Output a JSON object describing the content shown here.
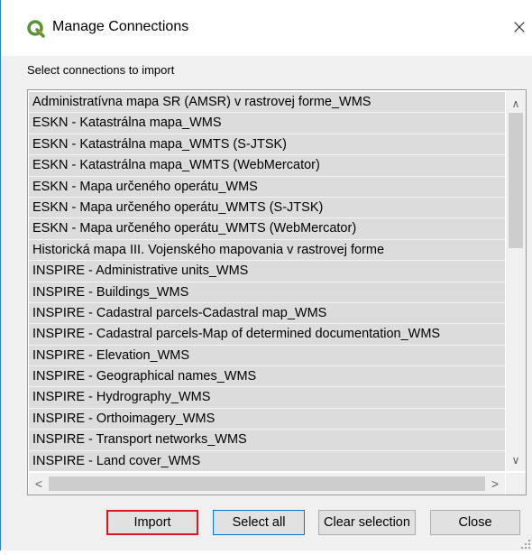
{
  "window": {
    "title": "Manage Connections",
    "close_glyph": "×",
    "app_icon": "qgis-icon",
    "accent": "#3c7fb1"
  },
  "prompt": "Select connections to import",
  "connections": [
    "Administratívna mapa SR (AMSR) v rastrovej forme_WMS",
    "ESKN - Katastrálna mapa_WMS",
    "ESKN - Katastrálna mapa_WMTS (S-JTSK)",
    "ESKN - Katastrálna mapa_WMTS (WebMercator)",
    "ESKN - Mapa určeného operátu_WMS",
    "ESKN - Mapa určeného operátu_WMTS (S-JTSK)",
    "ESKN - Mapa určeného operátu_WMTS (WebMercator)",
    "Historická mapa III. Vojenského mapovania v rastrovej forme",
    "INSPIRE - Administrative units_WMS",
    "INSPIRE - Buildings_WMS",
    "INSPIRE - Cadastral parcels-Cadastral map_WMS",
    "INSPIRE - Cadastral parcels-Map of determined documentation_WMS",
    "INSPIRE - Elevation_WMS",
    "INSPIRE - Geographical names_WMS",
    "INSPIRE - Hydrography_WMS",
    "INSPIRE - Orthoimagery_WMS",
    "INSPIRE - Transport networks_WMS",
    "INSPIRE - Land cover_WMS"
  ],
  "scroll": {
    "up": "∧",
    "down": "∨",
    "left": "<",
    "right": ">"
  },
  "buttons": {
    "import": "Import",
    "select_all": "Select all",
    "clear_selection": "Clear selection",
    "close": "Close"
  },
  "colors": {
    "selected_row": "#dcdcdc",
    "import_highlight": "#e0141e",
    "focus_border": "#0078d7"
  }
}
